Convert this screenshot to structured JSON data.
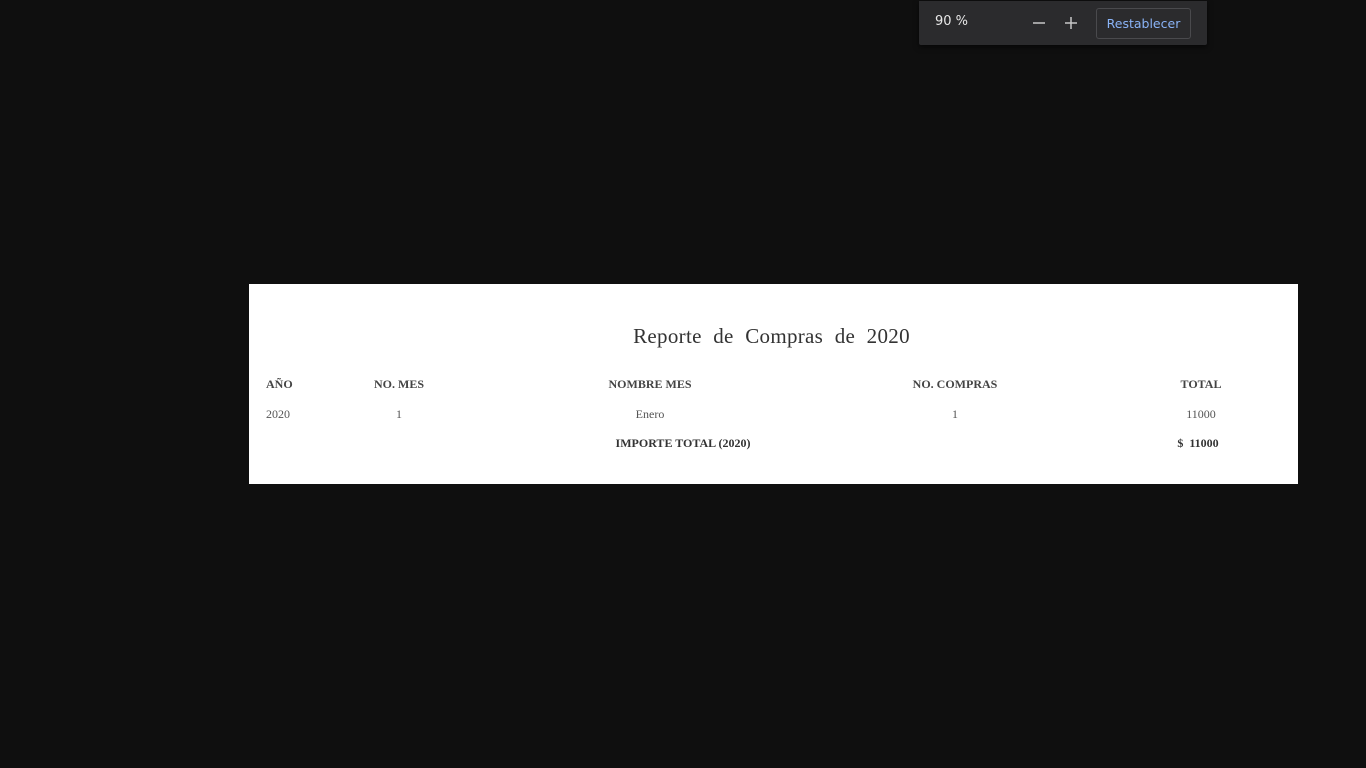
{
  "zoom_bar": {
    "level": "90 %",
    "reset_label": "Restablecer",
    "minus_icon": "minus-icon",
    "plus_icon": "plus-icon"
  },
  "report": {
    "title": "Reporte  de  Compras  de  2020",
    "headers": {
      "anio": "AÑO",
      "no_mes": "NO. MES",
      "nombre_mes": "NOMBRE MES",
      "no_compras": "NO. COMPRAS",
      "total": "TOTAL"
    },
    "rows": [
      {
        "anio": "2020",
        "no_mes": "1",
        "nombre_mes": "Enero",
        "no_compras": "1",
        "total": "11000"
      }
    ],
    "total_label": "IMPORTE TOTAL (2020)",
    "total_value": "$  11000"
  },
  "colors": {
    "background": "#0f0f0f",
    "toolbar": "#2b2b2d",
    "accent": "#8ab4f8",
    "page": "#ffffff"
  }
}
